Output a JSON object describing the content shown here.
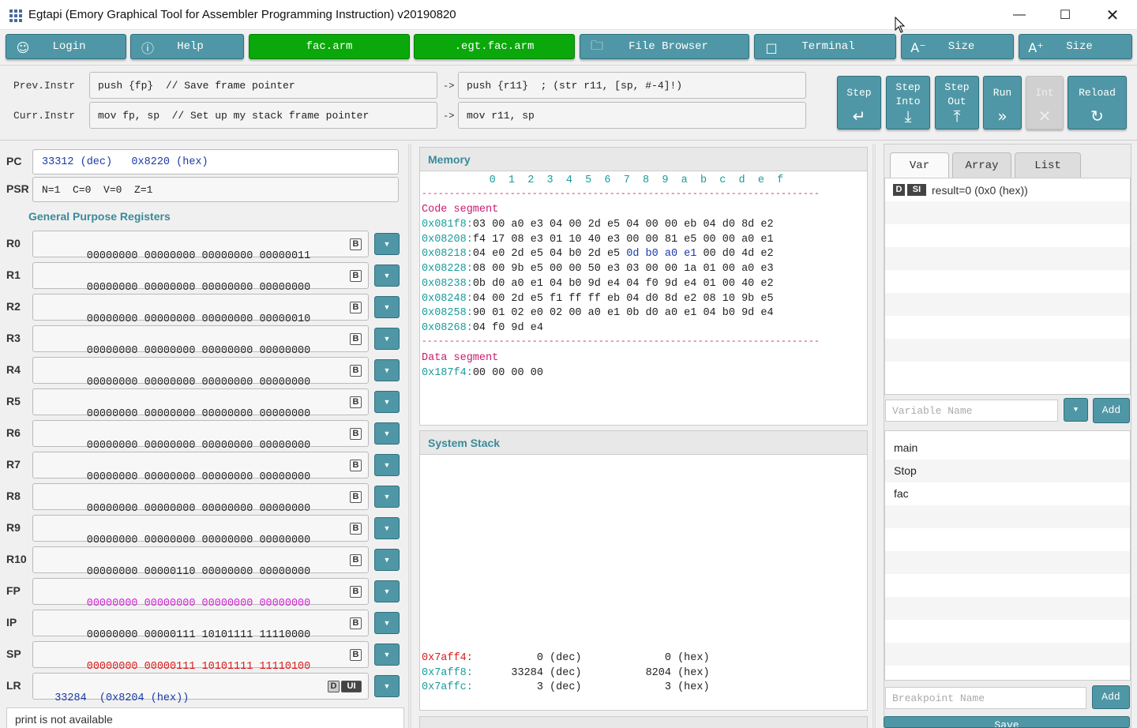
{
  "window": {
    "title": "Egtapi (Emory Graphical Tool for Assembler Programming Instruction) v20190820"
  },
  "toolbar": {
    "login": "Login",
    "help": "Help",
    "file1": "fac.arm",
    "file2": ".egt.fac.arm",
    "file_browser": "File Browser",
    "terminal": "Terminal",
    "size_down": "Size",
    "size_up": "Size"
  },
  "instr": {
    "prev_label": "Prev.Instr",
    "curr_label": "Curr.Instr",
    "prev_src": "push {fp}  // Save frame pointer",
    "prev_exp": "push {r11}  ; (str r11, [sp, #-4]!)",
    "curr_src": "mov fp, sp  // Set up my stack frame pointer",
    "curr_exp": "mov r11, sp",
    "arrow": "->"
  },
  "controls": {
    "step": "Step",
    "step_into": "Step\nInto",
    "step_out": "Step\nOut",
    "run": "Run",
    "int": "Int",
    "reload": "Reload"
  },
  "regs": {
    "pc_label": "PC",
    "pc_value": "33312 (dec)   0x8220 (hex)",
    "psr_label": "PSR",
    "psr_value": "N=1  C=0  V=0  Z=1",
    "gpr_title": "General Purpose Registers",
    "b_label": "B",
    "list": [
      {
        "name": "R0",
        "value": "00000000 00000000 00000000 00000011",
        "color": "#222222"
      },
      {
        "name": "R1",
        "value": "00000000 00000000 00000000 00000000",
        "color": "#222222"
      },
      {
        "name": "R2",
        "value": "00000000 00000000 00000000 00000010",
        "color": "#222222"
      },
      {
        "name": "R3",
        "value": "00000000 00000000 00000000 00000000",
        "color": "#222222"
      },
      {
        "name": "R4",
        "value": "00000000 00000000 00000000 00000000",
        "color": "#222222"
      },
      {
        "name": "R5",
        "value": "00000000 00000000 00000000 00000000",
        "color": "#222222"
      },
      {
        "name": "R6",
        "value": "00000000 00000000 00000000 00000000",
        "color": "#222222"
      },
      {
        "name": "R7",
        "value": "00000000 00000000 00000000 00000000",
        "color": "#222222"
      },
      {
        "name": "R8",
        "value": "00000000 00000000 00000000 00000000",
        "color": "#222222"
      },
      {
        "name": "R9",
        "value": "00000000 00000000 00000000 00000000",
        "color": "#222222"
      },
      {
        "name": "R10",
        "value": "00000000 00000110 00000000 00000000",
        "color": "#222222"
      },
      {
        "name": "FP",
        "value": "00000000 00000000 00000000 00000000",
        "color": "#d21fd2"
      },
      {
        "name": "IP",
        "value": "00000000 00000111 10101111 11110000",
        "color": "#222222"
      },
      {
        "name": "SP",
        "value": "00000000 00000111 10101111 11110100",
        "color": "#d81a1a"
      }
    ],
    "lr_label": "LR",
    "lr_value": "33284  (0x8204 (hex))",
    "lr_d": "D",
    "lr_ui": "UI"
  },
  "status": "print is not available",
  "memory": {
    "title": "Memory",
    "header": "      0  1  2  3  4  5  6  7  8  9  a  b  c  d  e  f",
    "dashes": "------------------------------------------------------------------------",
    "code_label": "Code segment",
    "code": [
      {
        "addr": "0x081f8:",
        "bytes": "03 00 a0 e3 04 00 2d e5 04 00 00 eb 04 d0 8d e2"
      },
      {
        "addr": "0x08208:",
        "bytes": "f4 17 08 e3 01 10 40 e3 00 00 81 e5 00 00 a0 e1"
      },
      {
        "addr": "0x08218:",
        "pre": "04 e0 2d e5 04 b0 2d e5 ",
        "hi": "0d b0 a0 e1",
        "post": " 00 d0 4d e2"
      },
      {
        "addr": "0x08228:",
        "bytes": "08 00 9b e5 00 00 50 e3 03 00 00 1a 01 00 a0 e3"
      },
      {
        "addr": "0x08238:",
        "bytes": "0b d0 a0 e1 04 b0 9d e4 04 f0 9d e4 01 00 40 e2"
      },
      {
        "addr": "0x08248:",
        "bytes": "04 00 2d e5 f1 ff ff eb 04 d0 8d e2 08 10 9b e5"
      },
      {
        "addr": "0x08258:",
        "bytes": "90 01 02 e0 02 00 a0 e1 0b d0 a0 e1 04 b0 9d e4"
      },
      {
        "addr": "0x08268:",
        "bytes": "04 f0 9d e4"
      }
    ],
    "data_label": "Data segment",
    "data": [
      {
        "addr": "0x187f4:",
        "bytes": "00 00 00 00"
      }
    ]
  },
  "stack": {
    "title": "System Stack",
    "rows": [
      {
        "addr": "0x7aff4:",
        "dec": "    0 (dec)",
        "hex": "   0 (hex)",
        "addr_color": "#d81a1a"
      },
      {
        "addr": "0x7aff8:",
        "dec": "33284 (dec)",
        "hex": "8204 (hex)",
        "addr_color": "#1a9b9b"
      },
      {
        "addr": "0x7affc:",
        "dec": "    3 (dec)",
        "hex": "   3 (hex)",
        "addr_color": "#1a9b9b"
      }
    ]
  },
  "right": {
    "tabs": [
      "Var",
      "Array",
      "List"
    ],
    "var_item": {
      "d": "D",
      "si": "SI",
      "text": "result=0 (0x0 (hex))"
    },
    "var_placeholder": "Variable Name",
    "add": "Add",
    "funcs": [
      "main",
      "Stop",
      "fac"
    ],
    "bp_placeholder": "Breakpoint Name",
    "save": "Save"
  }
}
